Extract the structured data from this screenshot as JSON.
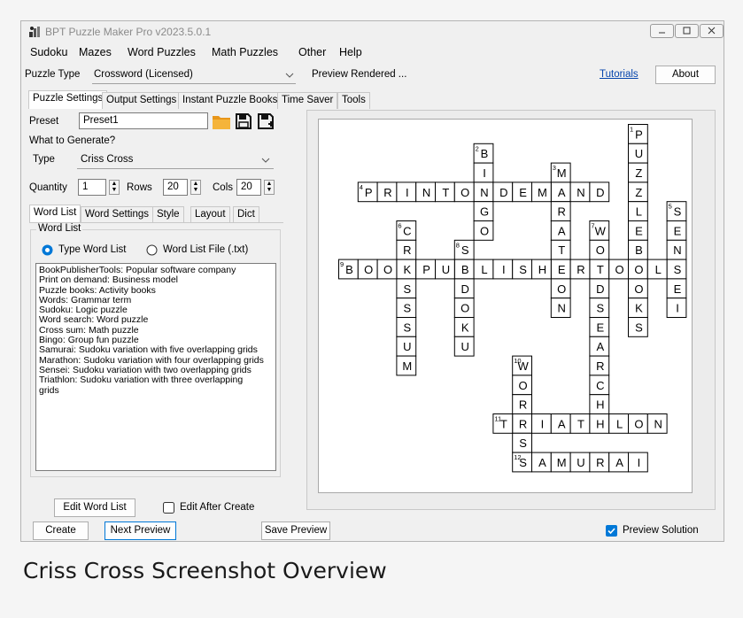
{
  "window": {
    "title": "BPT Puzzle Maker Pro v2023.5.0.1",
    "buttons": [
      "minimize-button",
      "maximize-button",
      "close-button"
    ]
  },
  "menu": [
    "Sudoku",
    "Mazes",
    "Word Puzzles",
    "Math Puzzles",
    "Other",
    "Help"
  ],
  "toolbar": {
    "puzzle_type_label": "Puzzle Type",
    "puzzle_type_value": "Crossword (Licensed)",
    "status": "Preview Rendered ...",
    "tutorials_link": "Tutorials",
    "about_button": "About"
  },
  "tabs": [
    "Puzzle Settings",
    "Output Settings",
    "Instant Puzzle Books",
    "Time Saver",
    "Tools"
  ],
  "settings": {
    "preset_label": "Preset",
    "preset_value": "Preset1",
    "what_to_generate": "What to Generate?",
    "type_label": "Type",
    "type_value": "Criss Cross",
    "quantity_label": "Quantity",
    "quantity_value": "1",
    "rows_label": "Rows",
    "rows_value": "20",
    "cols_label": "Cols",
    "cols_value": "20"
  },
  "subtabs": [
    "Word List",
    "Word Settings",
    "Style",
    "Layout",
    "Dict"
  ],
  "word_list": {
    "group_label": "Word List",
    "radio_type": "Type Word List",
    "radio_file": "Word List File (.txt)",
    "lines": [
      "BookPublisherTools: Popular software company",
      "Print on demand: Business model",
      "Puzzle books: Activity books",
      "Words: Grammar term",
      "Sudoku: Logic puzzle",
      "Word search: Word puzzle",
      "Cross sum: Math puzzle",
      "Bingo: Group fun puzzle",
      "Samurai: Sudoku variation with five overlapping grids",
      "Marathon: Sudoku variation with four overlapping grids",
      "Sensei: Sudoku variation with two overlapping grids",
      "Triathlon: Sudoku variation with three overlapping",
      "grids"
    ],
    "edit_button": "Edit Word List",
    "edit_after_create": "Edit After Create"
  },
  "bottom": {
    "create_button": "Create",
    "next_preview_button": "Next Preview",
    "save_preview_button": "Save Preview",
    "preview_solution": "Preview Solution"
  },
  "crossword": {
    "entries": [
      {
        "num": "1",
        "word": "PUZZLEBOOKS",
        "dir": "down",
        "row": 0,
        "col": 15
      },
      {
        "num": "2",
        "word": "BINGO",
        "dir": "down",
        "row": 1,
        "col": 7
      },
      {
        "num": "3",
        "word": "MARATHON",
        "dir": "down",
        "row": 2,
        "col": 11
      },
      {
        "num": "4",
        "word": "PRINTONDEMAND",
        "dir": "across",
        "row": 3,
        "col": 1
      },
      {
        "num": "5",
        "word": "SENSEI",
        "dir": "down",
        "row": 4,
        "col": 17
      },
      {
        "num": "6",
        "word": "CROSSSUM",
        "dir": "down",
        "row": 5,
        "col": 3
      },
      {
        "num": "7",
        "word": "WORDSEARCH",
        "dir": "down",
        "row": 5,
        "col": 13
      },
      {
        "num": "8",
        "word": "SUDOKU",
        "dir": "down",
        "row": 6,
        "col": 6
      },
      {
        "num": "9",
        "word": "BOOKPUBLISHERTOOLS",
        "dir": "across",
        "row": 7,
        "col": 0
      },
      {
        "num": "10",
        "word": "WORDS",
        "dir": "down",
        "row": 12,
        "col": 9
      },
      {
        "num": "11",
        "word": "TRIATHLON",
        "dir": "across",
        "row": 15,
        "col": 8
      },
      {
        "num": "12",
        "word": "SAMURAI",
        "dir": "across",
        "row": 17,
        "col": 9
      }
    ]
  },
  "caption": "Criss Cross Screenshot Overview",
  "colors": {
    "accent_blue": "#0078d7",
    "folder_icon": "#f0a020",
    "link": "#0645ad"
  }
}
